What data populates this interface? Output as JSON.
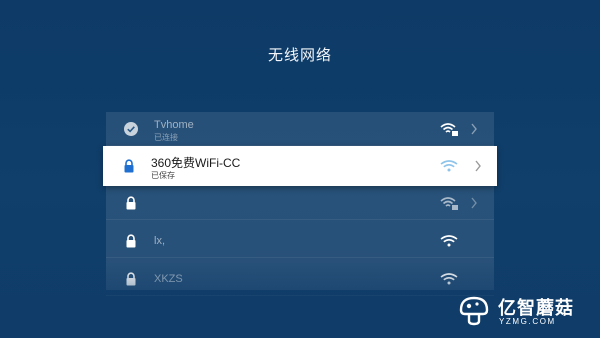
{
  "screen": {
    "title": "无线网络"
  },
  "networks": [
    {
      "name": "Tvhome",
      "status": "已连接",
      "lead_icon": "check-circle-icon",
      "signal_icon": "wifi-6-icon"
    },
    {
      "name": "360免费WiFi-CC",
      "status": "已保存",
      "lead_icon": "lock-icon",
      "signal_icon": "wifi-icon",
      "selected": true
    },
    {
      "name": "",
      "status": "",
      "lead_icon": "lock-icon",
      "signal_icon": "wifi-6-icon"
    },
    {
      "name": "lx,",
      "status": "",
      "lead_icon": "lock-icon",
      "signal_icon": "wifi-icon"
    },
    {
      "name": "XKZS",
      "status": "",
      "lead_icon": "lock-icon",
      "signal_icon": "wifi-icon"
    }
  ],
  "watermark": {
    "brand": "亿智蘑菇",
    "url": "YZMG.COM"
  },
  "colors": {
    "background": "#0f3c68",
    "selected_row": "#ffffff",
    "lock_selected": "#1f6fd1"
  }
}
